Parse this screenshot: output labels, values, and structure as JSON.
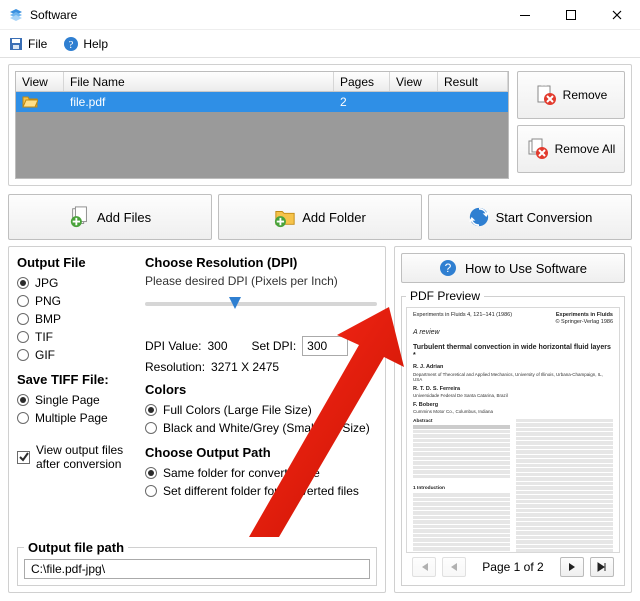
{
  "window": {
    "title": "Software"
  },
  "menu": {
    "file": "File",
    "help": "Help"
  },
  "buttons": {
    "remove": "Remove",
    "remove_all": "Remove All",
    "add_files": "Add Files",
    "add_folder": "Add Folder",
    "start_conversion": "Start Conversion",
    "how_to": "How to Use Software"
  },
  "table": {
    "headers": {
      "view": "View",
      "file_name": "File Name",
      "pages": "Pages",
      "view2": "View",
      "result": "Result"
    },
    "rows": [
      {
        "file_name": "file.pdf",
        "pages": "2",
        "result": ""
      }
    ]
  },
  "output_file": {
    "title": "Output File",
    "options": {
      "jpg": "JPG",
      "png": "PNG",
      "bmp": "BMP",
      "tif": "TIF",
      "gif": "GIF"
    }
  },
  "save_tiff": {
    "title": "Save TIFF File:",
    "single": "Single Page",
    "multiple": "Multiple Page"
  },
  "resolution": {
    "title": "Choose Resolution (DPI)",
    "subtitle": "Please desired DPI (Pixels per Inch)",
    "dpi_value_label": "DPI Value:",
    "dpi_value": "300",
    "set_dpi_label": "Set DPI:",
    "set_dpi": "300",
    "resolution_label": "Resolution:",
    "resolution_value": "3271 X 2475"
  },
  "colors": {
    "title": "Colors",
    "full": "Full Colors (Large File Size)",
    "bw": "Black and White/Grey (Small File Size)"
  },
  "output_path_section": {
    "title": "Choose Output Path",
    "same": "Same folder for converted file",
    "diff": "Set different folder for converted files"
  },
  "view_output": "View output files after conversion",
  "output_path": {
    "title": "Output file path",
    "value": "C:\\file.pdf-jpg\\"
  },
  "preview": {
    "legend": "PDF Preview",
    "pager": "Page 1 of 2",
    "doc": {
      "journal_left": "Experiments in Fluids 4, 121–141 (1986)",
      "journal_right": "Experiments in Fluids",
      "publisher": "© Springer-Verlag 1986",
      "review": "A review",
      "title": "Turbulent thermal convection in wide horizontal fluid layers *",
      "author1": "R. J. Adrian",
      "aff1": "Department of Theoretical and Applied Mechanics, University of Illinois, Urbana-Champaign, IL, USA",
      "author2": "R. T. D. S. Ferreira",
      "aff2": "Universidade Federal De Santa Catarina, Brazil",
      "author3": "F. Boberg",
      "aff3": "Cummins Motor Co., Columbus, Indiana",
      "abstract_label": "Abstract",
      "intro_label": "1 Introduction"
    }
  }
}
